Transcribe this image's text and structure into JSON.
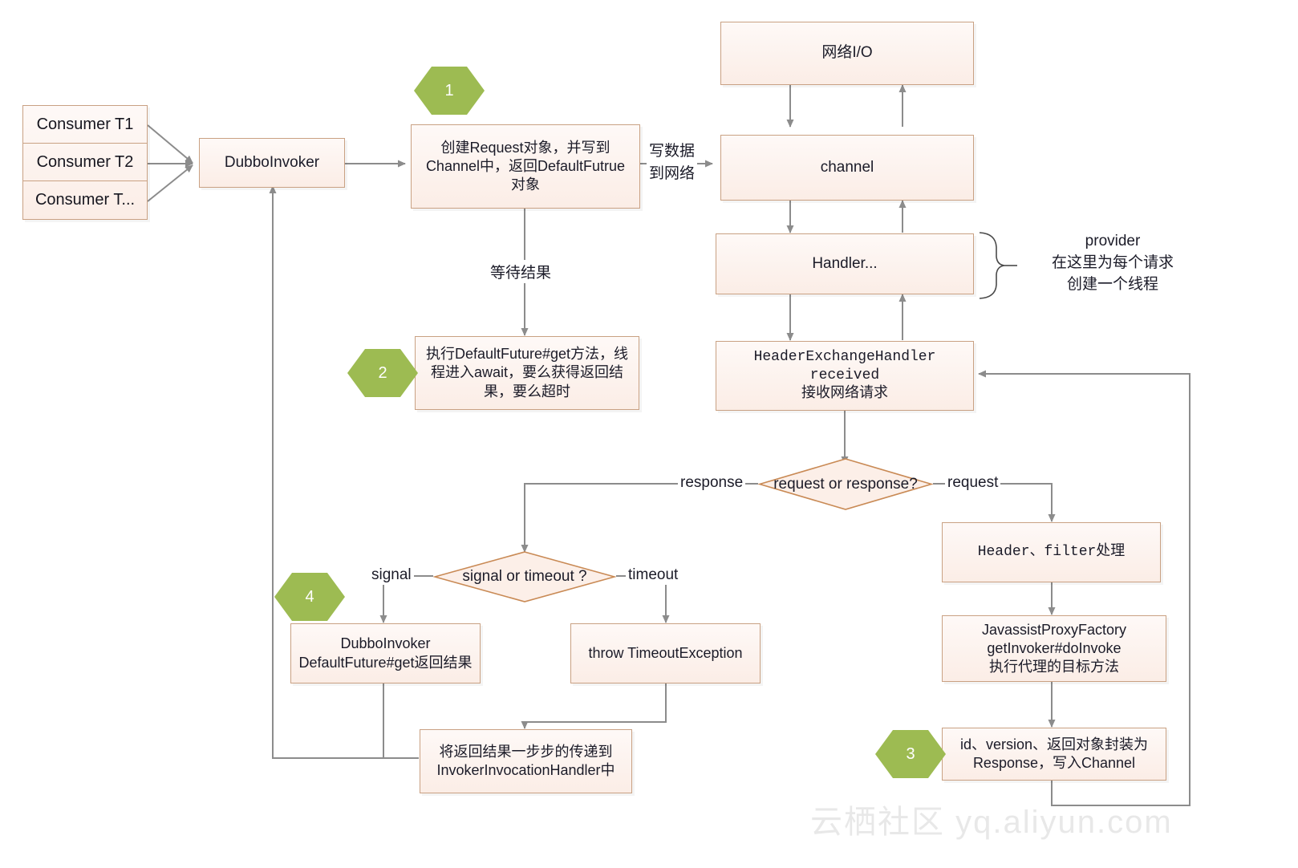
{
  "diagram": {
    "title": "Dubbo invocation flow",
    "colors": {
      "node_border": "#C9A183",
      "node_fill_top": "#FEF9F7",
      "node_fill_bottom": "#FBEDE6",
      "hexagon_green": "#9DBB52",
      "connector_gray": "#8C8C8C",
      "text": "#1b1b28"
    }
  },
  "consumer_stack": {
    "items": [
      {
        "label": "Consumer T1"
      },
      {
        "label": "Consumer T2"
      },
      {
        "label": "Consumer T..."
      }
    ]
  },
  "nodes": {
    "dubbo_invoker": "DubboInvoker",
    "create_request": "创建Request对象，并写到\nChannel中，返回DefaultFutrue\n对象",
    "network_io": "网络I/O",
    "channel": "channel",
    "handler": "Handler...",
    "header_exchange_handler": "HeaderExchangeHandler\nreceived\n接收网络请求",
    "default_future_get": "执行DefaultFuture#get方法，线\n程进入await，要么获得返回结\n果，要么超时",
    "dubbo_invoker_result": "DubboInvoker\nDefaultFuture#get返回结果",
    "throw_timeout": "throw TimeoutException",
    "deliver_result": "将返回结果一步步的传递到\nInvokerInvocationHandler中",
    "header_filter": "Header、filter处理",
    "javassist_proxy": "JavassistProxyFactory\ngetInvoker#doInvoke\n执行代理的目标方法",
    "wrap_response": "id、version、返回对象封装为\nResponse，写入Channel"
  },
  "decisions": {
    "request_or_response": "request or response?",
    "signal_or_timeout": "signal or timeout ?"
  },
  "edge_labels": {
    "write_data_to_network": "写数据\n到网络",
    "wait_result": "等待结果",
    "response": "response",
    "request": "request",
    "signal": "signal",
    "timeout": "timeout"
  },
  "step_badges": {
    "one": "1",
    "two": "2",
    "three": "3",
    "four": "4"
  },
  "annotations": {
    "provider_note": "provider\n在这里为每个请求\n创建一个线程"
  },
  "watermark": {
    "text": "云栖社区 yq.aliyun.com"
  }
}
